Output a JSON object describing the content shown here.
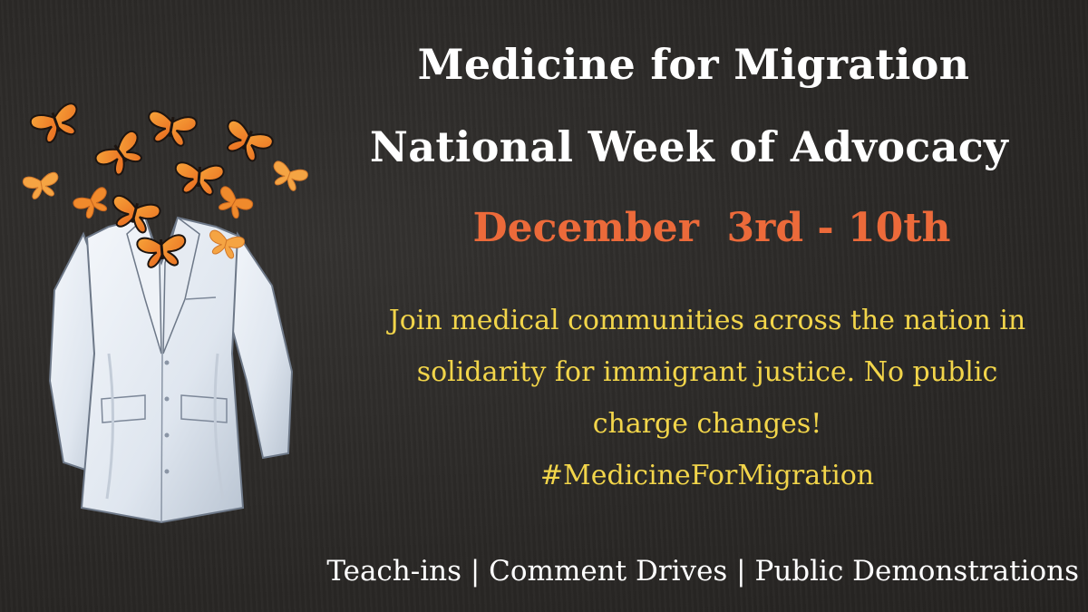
{
  "poster": {
    "title_line1": "Medicine for Migration",
    "title_line2": "National Week of Advocacy",
    "dates": "December  3rd - 10th",
    "body_line1": "Join medical communities across the nation in",
    "body_line2": "solidarity for immigrant justice. No public",
    "body_line3": "charge changes!",
    "hashtag": "#MedicineForMigration",
    "footer": "Teach-ins | Comment Drives | Public Demonstrations"
  },
  "illustration": {
    "subject": "white lab coat with monarch butterflies emerging from the collar",
    "icons": [
      "lab-coat-icon",
      "monarch-butterfly-icon"
    ]
  },
  "colors": {
    "background": "#2c2a28",
    "title": "#ffffff",
    "date": "#ec6a3a",
    "body": "#f2d54a",
    "footer": "#ffffff",
    "butterfly_orange": "#f0902a",
    "lab_coat": "#e9eef4"
  }
}
